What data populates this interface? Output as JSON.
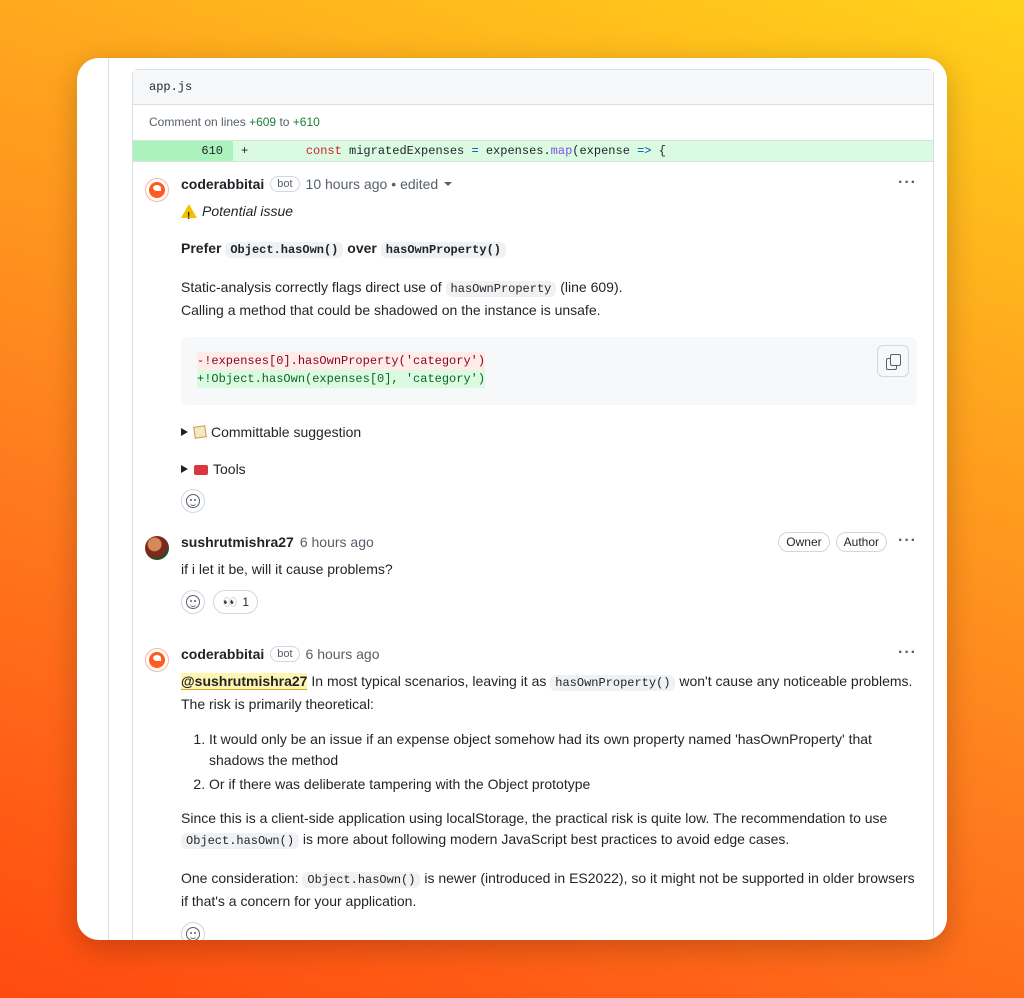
{
  "file": {
    "name": "app.js"
  },
  "comment_range": {
    "prefix": "Comment on lines",
    "start": "+609",
    "to": "to",
    "end": "+610"
  },
  "diff": {
    "line_number": "610",
    "sign": "+",
    "indent": "        ",
    "kw": "const",
    "var": " migratedExpenses ",
    "eq": "=",
    "obj": " expenses.",
    "method": "map",
    "rest1": "(expense ",
    "arrow": "=>",
    "rest2": " {"
  },
  "comments": [
    {
      "author": "coderabbitai",
      "badge": "bot",
      "time": "10 hours ago",
      "edited": "• edited",
      "issue_label": "Potential issue",
      "heading": {
        "prefer": "Prefer",
        "code1": "Object.hasOwn()",
        "over": "over",
        "code2": "hasOwnProperty()"
      },
      "para": {
        "t1": "Static-analysis correctly flags direct use of",
        "code": "hasOwnProperty",
        "t2": "(line 609).",
        "t3": "Calling a method that could be shadowed on the instance is unsafe."
      },
      "code_block": {
        "del": "-!expenses[0].hasOwnProperty('category')",
        "add": "+!Object.hasOwn(expenses[0], 'category')"
      },
      "details": [
        "Committable suggestion",
        "Tools"
      ]
    },
    {
      "author": "sushrutmishra27",
      "time": "6 hours ago",
      "roles": [
        "Owner",
        "Author"
      ],
      "body": "if i let it be, will it cause problems?",
      "reaction": {
        "icon": "eyes",
        "count": "1"
      }
    },
    {
      "author": "coderabbitai",
      "badge": "bot",
      "time": "6 hours ago",
      "mention": "@sushrutmishra27",
      "p1a": " In most typical scenarios, leaving it as",
      "p1code": "hasOwnProperty()",
      "p1b": " won't cause any noticeable problems. The risk is primarily theoretical:",
      "list": [
        "It would only be an issue if an expense object somehow had its own property named 'hasOwnProperty' that shadows the method",
        "Or if there was deliberate tampering with the Object prototype"
      ],
      "p2a": "Since this is a client-side application using localStorage, the practical risk is quite low. The recommendation to use",
      "p2code": "Object.hasOwn()",
      "p2b": " is more about following modern JavaScript best practices to avoid edge cases.",
      "p3a": "One consideration:",
      "p3code": "Object.hasOwn()",
      "p3b": " is newer (introduced in ES2022), so it might not be supported in older browsers if that's a concern for your application."
    }
  ],
  "more_icon": "kebab-horizontal"
}
